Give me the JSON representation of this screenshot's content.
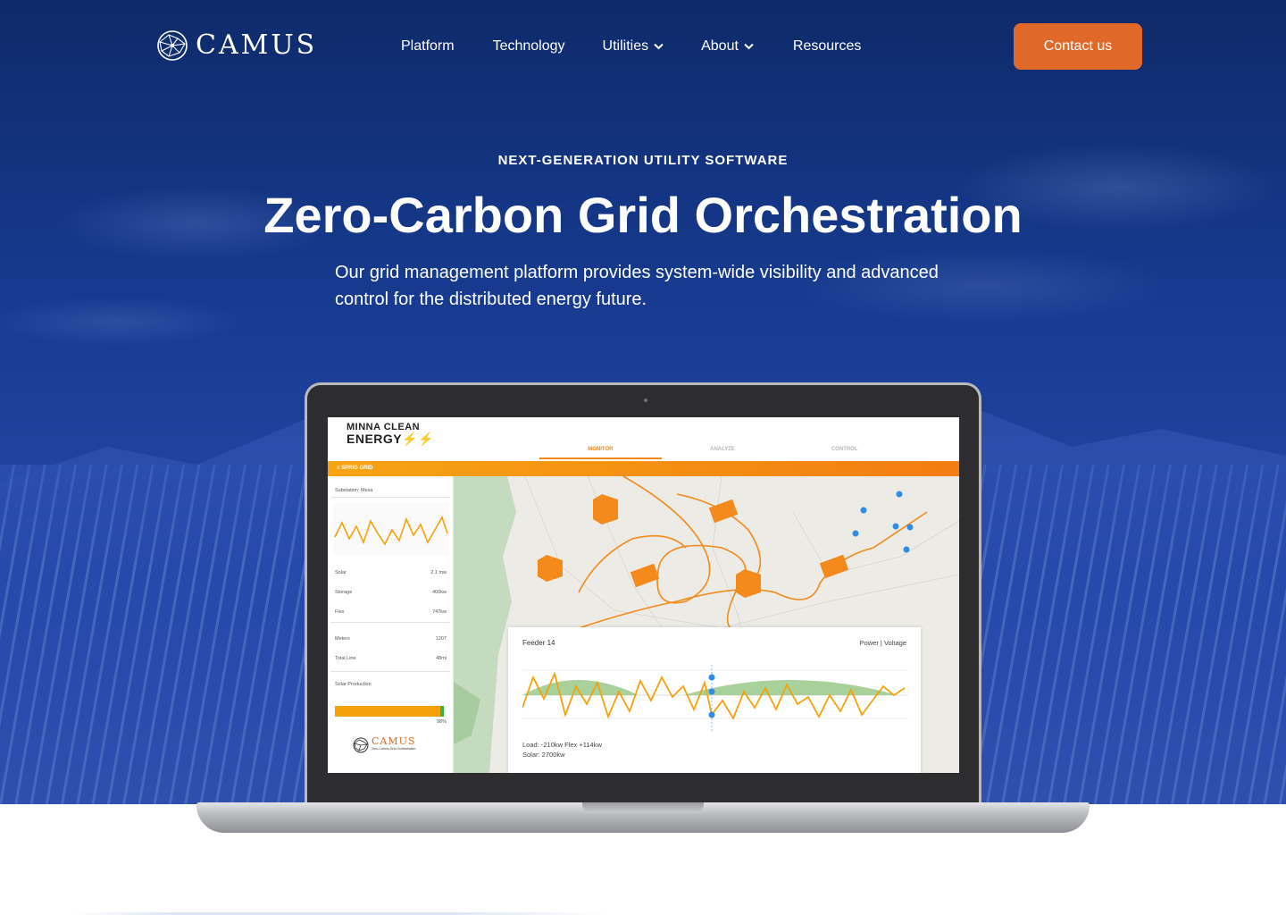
{
  "brand": {
    "logo_text": "CAMUS"
  },
  "nav": {
    "items": [
      {
        "label": "Platform",
        "has_dropdown": false
      },
      {
        "label": "Technology",
        "has_dropdown": false
      },
      {
        "label": "Utilities",
        "has_dropdown": true
      },
      {
        "label": "About",
        "has_dropdown": true
      },
      {
        "label": "Resources",
        "has_dropdown": false
      }
    ],
    "cta_label": "Contact us"
  },
  "hero": {
    "eyebrow": "NEXT-GENERATION UTILITY SOFTWARE",
    "headline": "Zero-Carbon Grid Orchestration",
    "subtext": "Our grid management platform provides system-wide visibility and advanced control for the distributed energy future."
  },
  "screen": {
    "brand_line1": "MINNA CLEAN",
    "brand_line2": "ENERGY",
    "tabs": [
      "MONITOR",
      "ANALYZE",
      "CONTROL"
    ],
    "active_tab": "MONITOR",
    "grid_bar": "≡  SPRIG GRID",
    "substation": "Substation: Mesa",
    "stats": [
      {
        "label": "Solar",
        "value": "2.1 mw"
      },
      {
        "label": "Storage",
        "value": "400kw"
      },
      {
        "label": "Flex",
        "value": "747kw"
      },
      {
        "label": "Meters",
        "value": "1207"
      },
      {
        "label": "Total Line",
        "value": "48mi"
      }
    ],
    "solar_production_label": "Solar Production",
    "solar_production_pct": "98%",
    "solar_production_fraction": 0.98,
    "footer_brand": "CAMUS",
    "footer_tagline": "Zero-Carbon Grid Orchestration",
    "feeder": {
      "title": "Feeder 14",
      "mode": "Power | Voltage",
      "load_line": "Load: -210kw  Flex +114kw",
      "solar_line": "Solar: 2700kw"
    }
  },
  "colors": {
    "accent": "#e0692a",
    "hero_blue": "#183c93",
    "screen_orange": "#f27d12"
  }
}
